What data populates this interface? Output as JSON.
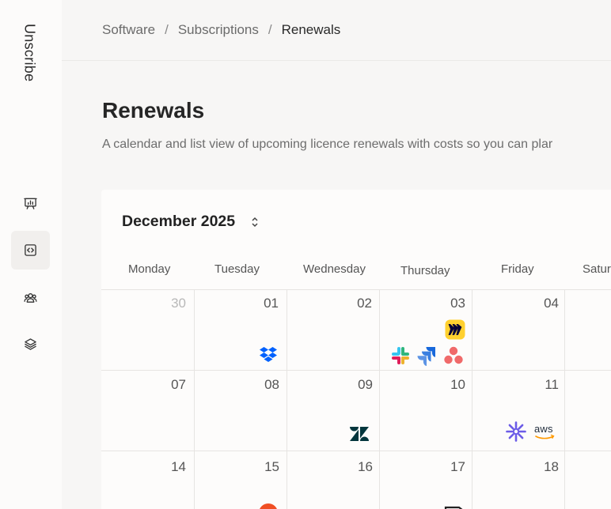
{
  "sidebar": {
    "brand": "Unscribe",
    "nav": [
      {
        "icon": "presentation-chart-icon"
      },
      {
        "icon": "code-icon",
        "active": true
      },
      {
        "icon": "users-icon"
      },
      {
        "icon": "layers-icon"
      }
    ]
  },
  "breadcrumb": {
    "items": [
      "Software",
      "Subscriptions",
      "Renewals"
    ],
    "separator": "/"
  },
  "page": {
    "title": "Renewals",
    "subtitle": "A calendar and list view of upcoming licence renewals with costs so you can plar"
  },
  "calendar": {
    "month_label": "December 2025",
    "weekdays": [
      "Monday",
      "Tuesday",
      "Wednesday",
      "Thursday",
      "Friday",
      "Satur"
    ],
    "weeks": [
      [
        "30",
        "01",
        "02",
        "03",
        "04"
      ],
      [
        "07",
        "08",
        "09",
        "10",
        "11"
      ],
      [
        "14",
        "15",
        "16",
        "17",
        "18"
      ]
    ],
    "aws_text": "aws",
    "colors": {
      "dropbox": "#0061fe",
      "miro": "#ffd02f",
      "asana": "#f06a6a",
      "jira": "#1868db",
      "zendesk": "#03363d",
      "zapier_star": "#6c5ce7"
    }
  }
}
